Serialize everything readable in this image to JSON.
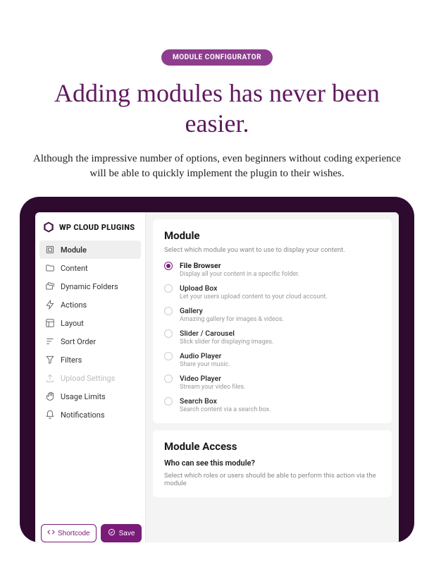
{
  "hero": {
    "badge": "MODULE CONFIGURATOR",
    "headline": "Adding modules has never been easier.",
    "subtext": "Although the impressive number of options, even beginners without coding experience will be able to quickly implement the plugin to their wishes."
  },
  "app": {
    "brand": "WP CLOUD PLUGINS",
    "sidebar": {
      "items": [
        {
          "label": "Module",
          "active": true,
          "disabled": false,
          "icon": "module"
        },
        {
          "label": "Content",
          "active": false,
          "disabled": false,
          "icon": "folder"
        },
        {
          "label": "Dynamic Folders",
          "active": false,
          "disabled": false,
          "icon": "folders"
        },
        {
          "label": "Actions",
          "active": false,
          "disabled": false,
          "icon": "bolt"
        },
        {
          "label": "Layout",
          "active": false,
          "disabled": false,
          "icon": "layout"
        },
        {
          "label": "Sort Order",
          "active": false,
          "disabled": false,
          "icon": "sort"
        },
        {
          "label": "Filters",
          "active": false,
          "disabled": false,
          "icon": "filter"
        },
        {
          "label": "Upload Settings",
          "active": false,
          "disabled": true,
          "icon": "upload"
        },
        {
          "label": "Usage Limits",
          "active": false,
          "disabled": false,
          "icon": "hand"
        },
        {
          "label": "Notifications",
          "active": false,
          "disabled": false,
          "icon": "bell"
        }
      ]
    },
    "buttons": {
      "shortcode": "Shortcode",
      "save": "Save"
    },
    "module_panel": {
      "title": "Module",
      "desc": "Select which module you want to use to display your content.",
      "options": [
        {
          "label": "File Browser",
          "sub": "Display all your content in a specific folder.",
          "selected": true
        },
        {
          "label": "Upload Box",
          "sub": "Let your users upload content to your cloud account.",
          "selected": false
        },
        {
          "label": "Gallery",
          "sub": "Amazing gallery for images & videos.",
          "selected": false
        },
        {
          "label": "Slider / Carousel",
          "sub": "Slick slider for displaying images.",
          "selected": false
        },
        {
          "label": "Audio Player",
          "sub": "Share your music.",
          "selected": false
        },
        {
          "label": "Video Player",
          "sub": "Stream your video files.",
          "selected": false
        },
        {
          "label": "Search Box",
          "sub": "Search content via a search box.",
          "selected": false
        }
      ]
    },
    "access_panel": {
      "title": "Module Access",
      "subhead": "Who can see this module?",
      "desc": "Select which roles or users should be able to perform this action via the module"
    }
  }
}
